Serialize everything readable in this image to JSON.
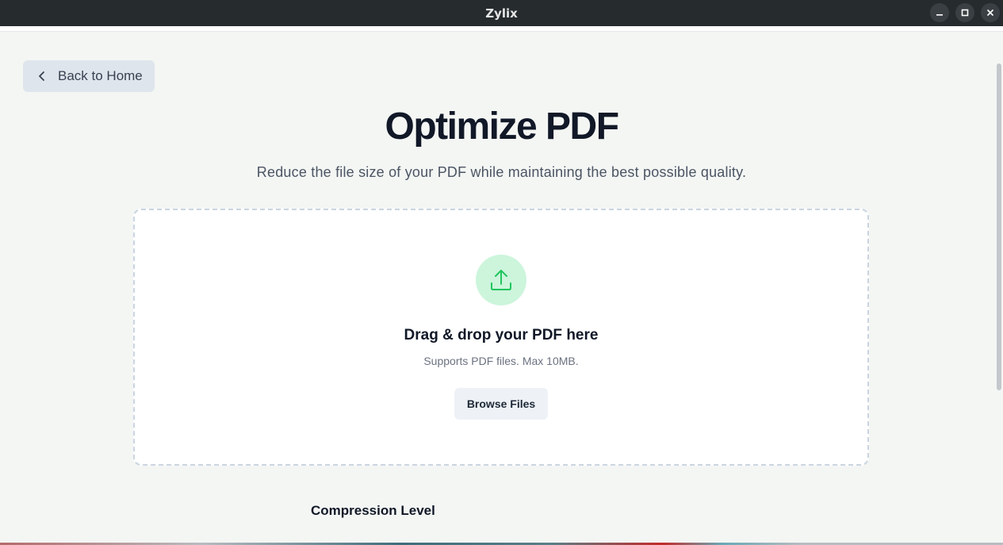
{
  "window": {
    "title": "Zylix",
    "controls": {
      "minimize": "minimize-icon",
      "maximize": "maximize-icon",
      "close": "close-icon"
    }
  },
  "nav": {
    "back_label": "Back to Home",
    "back_icon": "chevron-left-icon"
  },
  "header": {
    "title": "Optimize PDF",
    "subtitle": "Reduce the file size of your PDF while maintaining the best possible quality."
  },
  "dropzone": {
    "icon": "upload-icon",
    "heading": "Drag & drop your PDF here",
    "hint": "Supports PDF files. Max 10MB.",
    "browse_label": "Browse Files"
  },
  "compression": {
    "label": "Compression Level"
  },
  "colors": {
    "accent_green": "#22c55e",
    "accent_green_bg": "#ccf5dc",
    "titlebar": "#262b2e"
  }
}
